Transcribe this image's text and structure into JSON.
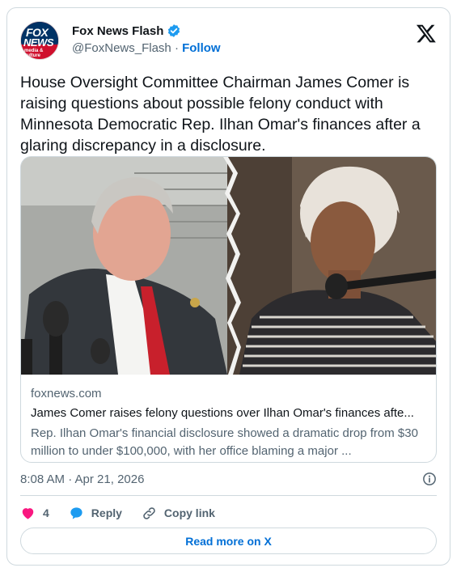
{
  "author": {
    "display_name": "Fox News Flash",
    "handle": "@FoxNews_Flash",
    "separator": "·",
    "follow_label": "Follow",
    "avatar_logo": [
      "FOX",
      "NEWS",
      "media & culture"
    ]
  },
  "tweet": {
    "text": "House Oversight Committee Chairman James Comer is raising questions about possible felony conduct with Minnesota Democratic Rep. Ilhan Omar's finances after a glaring discrepancy in a disclosure."
  },
  "link_card": {
    "domain": "foxnews.com",
    "title": "James Comer raises felony questions over Ilhan Omar's finances afte...",
    "description": "Rep. Ilhan Omar's financial disclosure showed a dramatic drop from $30 million to under $100,000, with her office blaming a major ..."
  },
  "timestamp": "8:08 AM · Apr 21, 2026",
  "actions": {
    "like_count": "4",
    "reply_label": "Reply",
    "copy_link_label": "Copy link"
  },
  "read_more_label": "Read more on X",
  "colors": {
    "link_blue": "#006fd6",
    "heart_red": "#f91880",
    "verified_blue": "#1d9bf0",
    "fox_red": "#cf102d",
    "fox_navy": "#003366"
  }
}
